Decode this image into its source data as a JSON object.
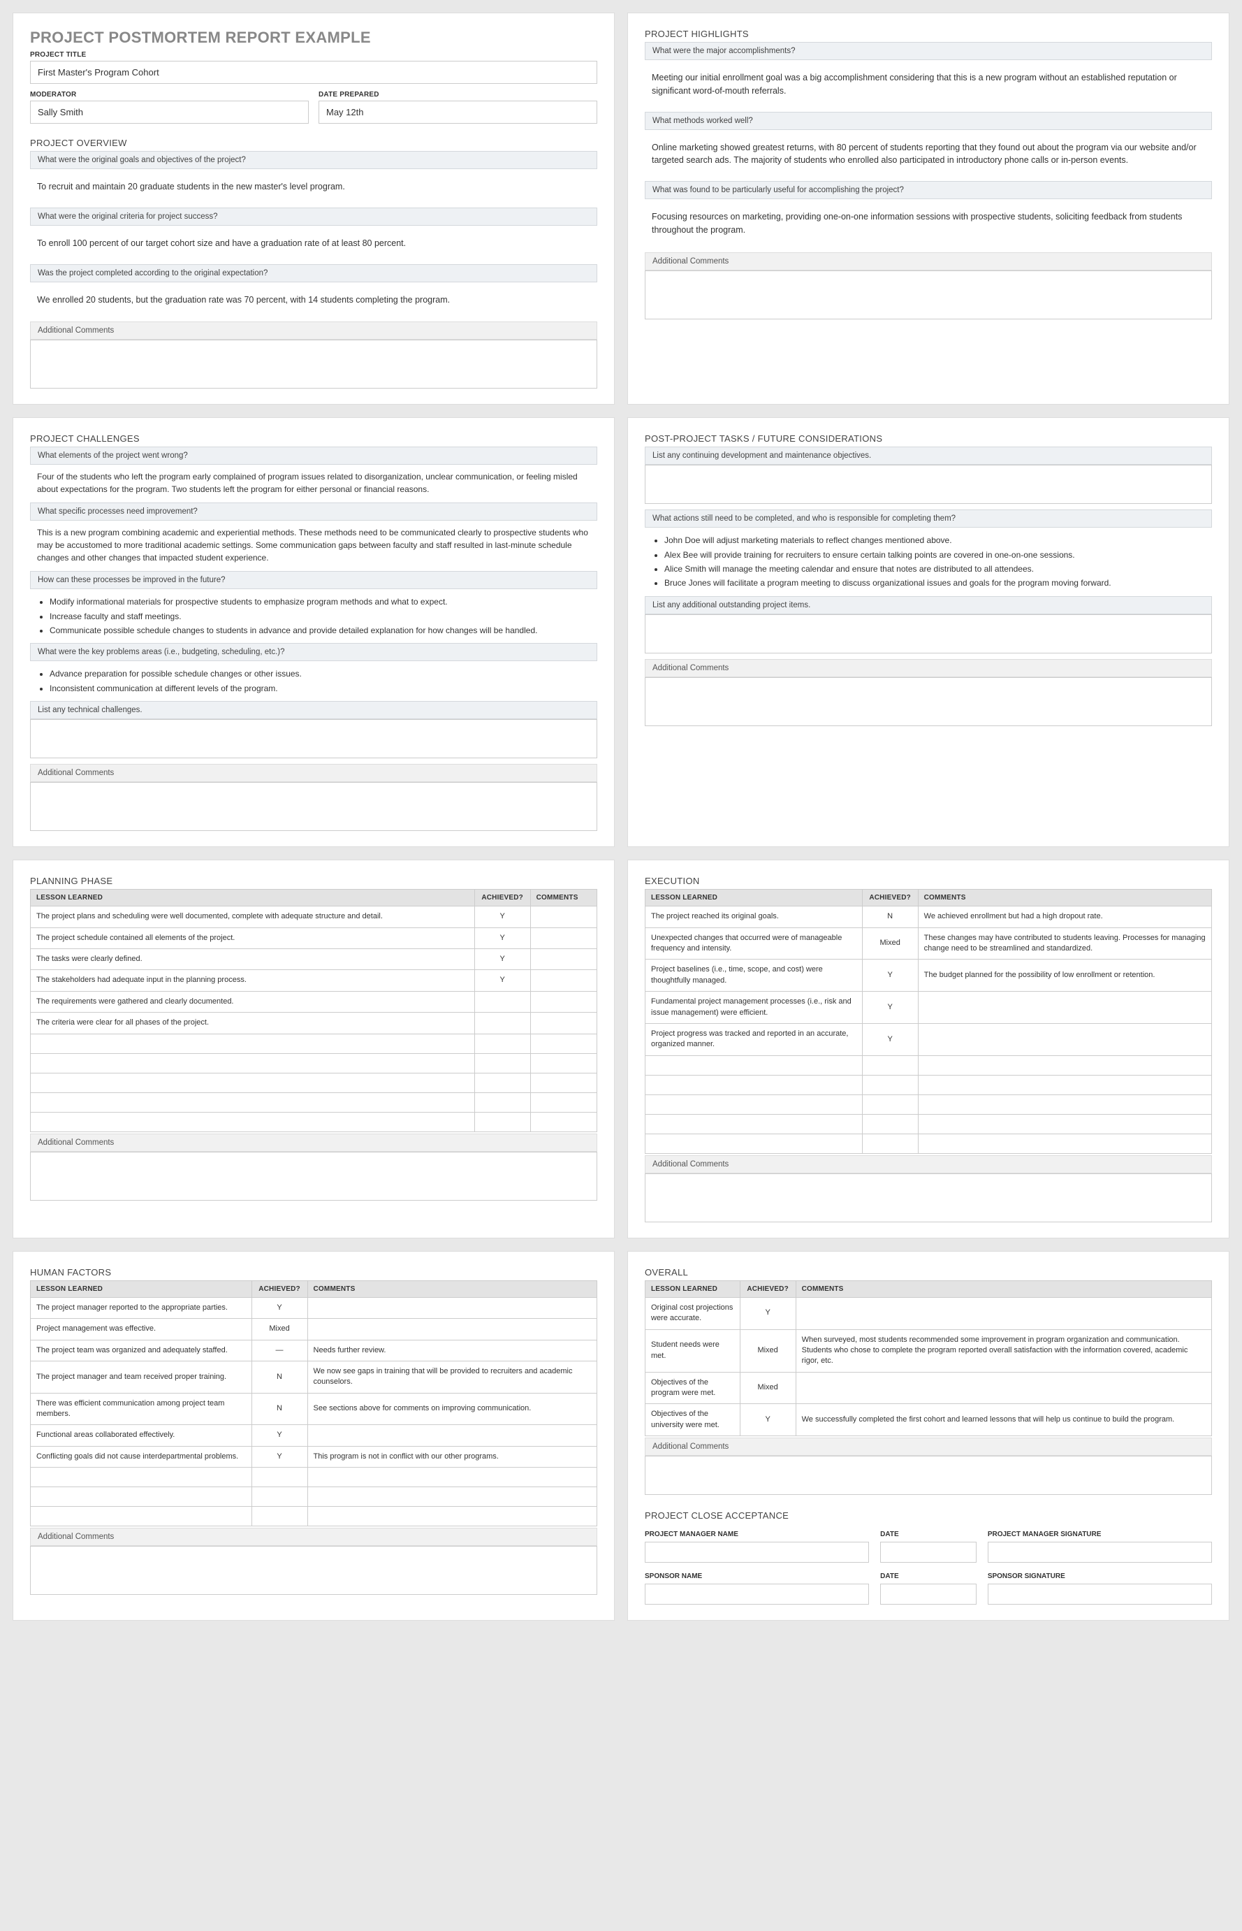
{
  "head": {
    "main_title": "PROJECT POSTMORTEM REPORT EXAMPLE",
    "project_title_label": "PROJECT TITLE",
    "project_title": "First Master's Program Cohort",
    "moderator_label": "MODERATOR",
    "moderator": "Sally Smith",
    "date_label": "DATE PREPARED",
    "date": "May 12th"
  },
  "overview": {
    "heading": "PROJECT OVERVIEW",
    "q1": "What were the original goals and objectives of the project?",
    "a1": "To recruit and maintain 20 graduate students in the new master's level program.",
    "q2": "What were the original criteria for project success?",
    "a2": "To enroll 100 percent of our target cohort size and have a graduation rate of at least 80 percent.",
    "q3": "Was the project completed according to the original expectation?",
    "a3": "We enrolled 20 students, but the graduation rate was 70 percent, with 14 students completing the program.",
    "addl": "Additional Comments"
  },
  "highlights": {
    "heading": "PROJECT HIGHLIGHTS",
    "q1": "What were the major accomplishments?",
    "a1": "Meeting our initial enrollment goal was a big accomplishment considering that this is a new program without an established reputation or significant word-of-mouth referrals.",
    "q2": "What methods worked well?",
    "a2": "Online marketing showed greatest returns, with 80 percent of students reporting that they found out about the program via our website and/or targeted search ads. The majority of students who enrolled also participated in introductory phone calls or in-person events.",
    "q3": "What was found to be particularly useful for accomplishing the project?",
    "a3": "Focusing resources on marketing, providing one-on-one information sessions with prospective students, soliciting feedback from students throughout the program.",
    "addl": "Additional Comments"
  },
  "challenges": {
    "heading": "PROJECT CHALLENGES",
    "q1": "What elements of the project went wrong?",
    "a1": "Four of the students who left the program early complained of program issues related to disorganization, unclear communication, or feeling misled  about expectations for the program. Two students left the program for either personal or financial reasons.",
    "q2": "What specific processes need improvement?",
    "a2": "This is a new program combining academic and experiential methods. These methods need to be communicated clearly to prospective students who may be accustomed to more traditional academic settings. Some communication gaps between faculty and staff resulted in last-minute schedule changes and other changes that impacted student experience.",
    "q3": "How can these processes be improved in the future?",
    "b3_1": "Modify informational materials for prospective students to emphasize program methods and what to expect.",
    "b3_2": "Increase faculty and staff meetings.",
    "b3_3": "Communicate possible schedule changes to students in advance and provide detailed explanation for how changes will be handled.",
    "q4": "What were the key problems areas (i.e., budgeting, scheduling, etc.)?",
    "b4_1": "Advance preparation for possible schedule changes or other issues.",
    "b4_2": "Inconsistent communication at different levels of the program.",
    "q5": "List any technical challenges.",
    "addl": "Additional Comments"
  },
  "post": {
    "heading": "POST-PROJECT TASKS / FUTURE CONSIDERATIONS",
    "q1": "List any continuing development and maintenance objectives.",
    "q2": "What actions still need to be completed, and who is responsible for completing them?",
    "b1": "John Doe will adjust marketing materials to reflect changes mentioned above.",
    "b2": "Alex Bee will provide training for recruiters to ensure certain talking points are covered in one-on-one sessions.",
    "b3": "Alice Smith will manage the meeting calendar and ensure that notes are distributed to all attendees.",
    "b4": "Bruce Jones will facilitate a program meeting to discuss organizational issues and goals for the program moving forward.",
    "q3": "List any additional outstanding project items.",
    "addl": "Additional Comments"
  },
  "th": {
    "lesson": "LESSON LEARNED",
    "ach": "ACHIEVED?",
    "com": "COMMENTS"
  },
  "planning": {
    "heading": "PLANNING PHASE",
    "rows": [
      {
        "l": "The project plans and scheduling were well documented, complete with adequate structure and detail.",
        "a": "Y",
        "c": ""
      },
      {
        "l": "The project schedule contained all elements of the project.",
        "a": "Y",
        "c": ""
      },
      {
        "l": "The tasks were clearly defined.",
        "a": "Y",
        "c": ""
      },
      {
        "l": "The stakeholders had adequate input in the planning process.",
        "a": "Y",
        "c": ""
      },
      {
        "l": "The requirements were gathered and clearly documented.",
        "a": "",
        "c": ""
      },
      {
        "l": "The criteria were clear for all phases of the project.",
        "a": "",
        "c": ""
      }
    ],
    "addl": "Additional Comments"
  },
  "execution": {
    "heading": "EXECUTION",
    "rows": [
      {
        "l": "The project reached its original goals.",
        "a": "N",
        "c": "We achieved enrollment but had a high dropout rate."
      },
      {
        "l": "Unexpected changes that occurred were of manageable frequency and intensity.",
        "a": "Mixed",
        "c": "These changes may have contributed to students leaving. Processes for managing change need to be streamlined and standardized."
      },
      {
        "l": "Project baselines (i.e., time, scope, and cost) were thoughtfully managed.",
        "a": "Y",
        "c": "The budget planned for the possibility of low enrollment or retention."
      },
      {
        "l": "Fundamental project management processes (i.e., risk and issue management) were efficient.",
        "a": "Y",
        "c": ""
      },
      {
        "l": "Project progress was tracked and reported in an accurate, organized manner.",
        "a": "Y",
        "c": ""
      }
    ],
    "addl": "Additional Comments"
  },
  "human": {
    "heading": "HUMAN FACTORS",
    "rows": [
      {
        "l": "The project manager reported to the appropriate parties.",
        "a": "Y",
        "c": ""
      },
      {
        "l": "Project management was effective.",
        "a": "Mixed",
        "c": ""
      },
      {
        "l": "The project team was organized and adequately staffed.",
        "a": "—",
        "c": "Needs further review."
      },
      {
        "l": "The project manager and team received proper training.",
        "a": "N",
        "c": "We now see gaps in training that will be provided to recruiters and academic counselors."
      },
      {
        "l": "There was efficient communication among project team members.",
        "a": "N",
        "c": "See sections above for comments on improving communication."
      },
      {
        "l": "Functional areas collaborated effectively.",
        "a": "Y",
        "c": ""
      },
      {
        "l": "Conflicting goals did not cause interdepartmental problems.",
        "a": "Y",
        "c": "This program is not in conflict with our other programs."
      }
    ],
    "addl": "Additional Comments"
  },
  "overall": {
    "heading": "OVERALL",
    "rows": [
      {
        "l": "Original cost projections were accurate.",
        "a": "Y",
        "c": ""
      },
      {
        "l": "Student needs were met.",
        "a": "Mixed",
        "c": "When surveyed, most students recommended some improvement in program organization and communication. Students who chose to complete the program reported overall satisfaction with the information covered, academic rigor, etc."
      },
      {
        "l": "Objectives of the program were met.",
        "a": "Mixed",
        "c": ""
      },
      {
        "l": "Objectives of the university were met.",
        "a": "Y",
        "c": "We successfully completed the first cohort and learned lessons that will help us continue to build the program."
      }
    ],
    "addl": "Additional Comments"
  },
  "close": {
    "heading": "PROJECT CLOSE ACCEPTANCE",
    "pm_name": "PROJECT MANAGER NAME",
    "date": "DATE",
    "pm_sig": "PROJECT MANAGER SIGNATURE",
    "sp_name": "SPONSOR NAME",
    "sp_sig": "SPONSOR SIGNATURE"
  }
}
